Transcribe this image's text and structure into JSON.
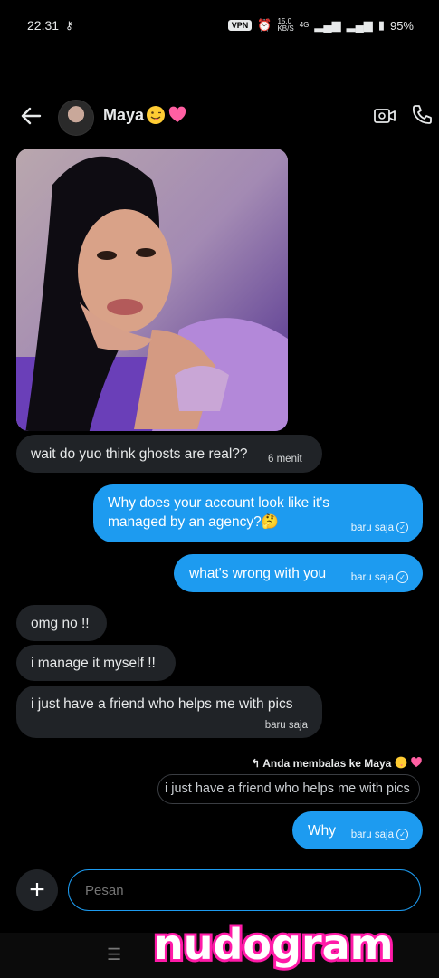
{
  "status_bar": {
    "time": "22.31",
    "vpn": "VPN",
    "speed_top": "15.0",
    "speed_unit": "KB/S",
    "network": "4G",
    "battery": "95%"
  },
  "header": {
    "contact_name": "Maya"
  },
  "messages": [
    {
      "text": "wait do yuo think ghosts are real??",
      "time": "6 menit"
    },
    {
      "text": "Why does your account look like it's managed by an agency?🤔",
      "time": "baru saja"
    },
    {
      "text": "what's wrong with you",
      "time": "baru saja"
    },
    {
      "text": "omg no !!"
    },
    {
      "text": "i manage it myself !!"
    },
    {
      "text": "i just have a friend who helps me with pics",
      "time": "baru saja"
    },
    {
      "text": "Why",
      "time": "baru saja"
    }
  ],
  "reply": {
    "label": "Anda membalas ke Maya",
    "quote": "i just have a friend who helps me with pics"
  },
  "composer": {
    "placeholder": "Pesan"
  },
  "watermark": "nudogram",
  "colors": {
    "accent": "#1d9bf0",
    "incoming_bubble": "#202327",
    "background": "#000000",
    "watermark_stroke": "#ff1aa8"
  },
  "icons": [
    "back-arrow-icon",
    "video-call-icon",
    "phone-icon",
    "plus-icon",
    "menu-icon",
    "key-icon",
    "alarm-icon",
    "signal-icon",
    "battery-icon",
    "reply-icon",
    "read-check-icon"
  ]
}
